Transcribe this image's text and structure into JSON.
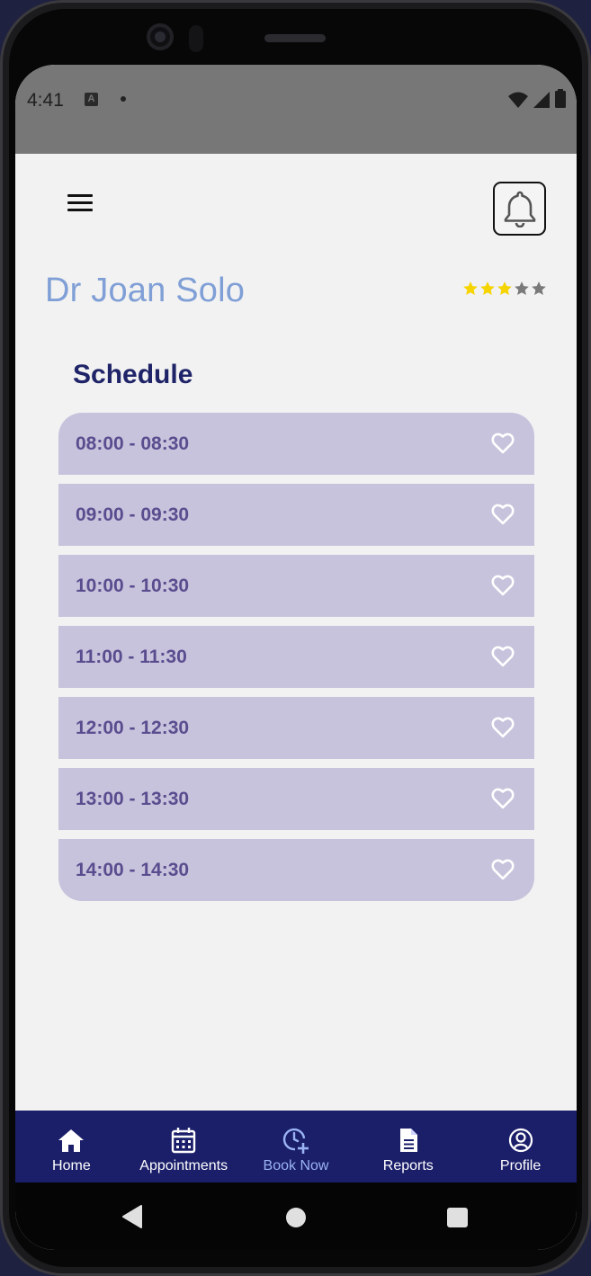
{
  "status_bar": {
    "time": "4:41",
    "notification_icon": "A",
    "icons": [
      "wifi-icon",
      "signal-icon",
      "battery-icon"
    ]
  },
  "header": {
    "menu_icon": "hamburger-menu-icon",
    "notification_icon": "bell-icon"
  },
  "doctor": {
    "name": "Dr Joan Solo",
    "rating": {
      "value": 3,
      "max": 5,
      "filled_color": "#f5d400",
      "empty_color": "#7a7a7a"
    }
  },
  "schedule": {
    "title": "Schedule",
    "slots": [
      {
        "time": "08:00 - 08:30",
        "icon": "heart-outline-icon"
      },
      {
        "time": "09:00 - 09:30",
        "icon": "heart-outline-icon"
      },
      {
        "time": "10:00 - 10:30",
        "icon": "heart-outline-icon"
      },
      {
        "time": "11:00 - 11:30",
        "icon": "heart-outline-icon"
      },
      {
        "time": "12:00 - 12:30",
        "icon": "heart-outline-icon"
      },
      {
        "time": "13:00 - 13:30",
        "icon": "heart-outline-icon"
      },
      {
        "time": "14:00 - 14:30",
        "icon": "heart-outline-icon"
      }
    ]
  },
  "nav": {
    "items": [
      {
        "label": "Home",
        "icon": "home-icon",
        "active": false
      },
      {
        "label": "Appointments",
        "icon": "calendar-icon",
        "active": false
      },
      {
        "label": "Book Now",
        "icon": "clock-plus-icon",
        "active": true
      },
      {
        "label": "Reports",
        "icon": "document-icon",
        "active": false
      },
      {
        "label": "Profile",
        "icon": "user-circle-icon",
        "active": false
      }
    ]
  },
  "colors": {
    "name": "#7f9fd6",
    "title": "#1f2468",
    "slot_bg": "#c8c3dc",
    "slot_text": "#5a4d8f",
    "nav_bg": "#1b1f6a",
    "nav_active": "#9ab3f2"
  },
  "system_nav": [
    "back-icon",
    "home-circle-icon",
    "recents-icon"
  ]
}
